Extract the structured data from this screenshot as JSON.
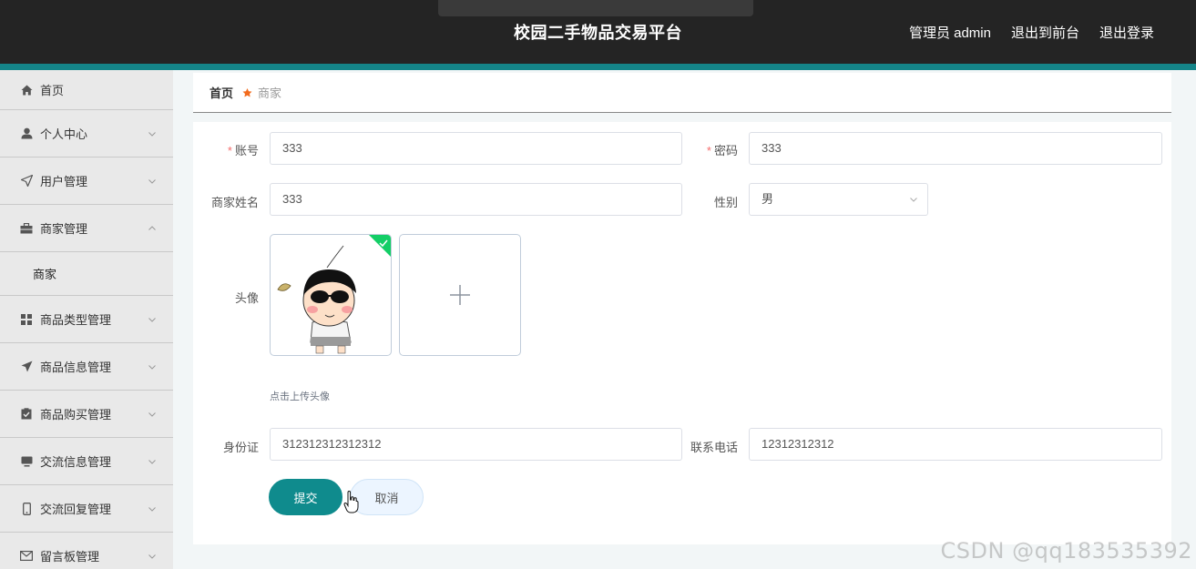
{
  "header": {
    "title": "校园二手物品交易平台",
    "user_label": "管理员 admin",
    "to_front_label": "退出到前台",
    "logout_label": "退出登录"
  },
  "sidebar": {
    "items": [
      {
        "label": "首页",
        "icon": "home-icon"
      },
      {
        "label": "个人中心",
        "icon": "user-icon"
      },
      {
        "label": "用户管理",
        "icon": "send-icon"
      },
      {
        "label": "商家管理",
        "icon": "briefcase-icon",
        "expanded": true,
        "children": [
          {
            "label": "商家"
          }
        ]
      },
      {
        "label": "商品类型管理",
        "icon": "grid-icon"
      },
      {
        "label": "商品信息管理",
        "icon": "paper-plane-icon"
      },
      {
        "label": "商品购买管理",
        "icon": "clipboard-check-icon"
      },
      {
        "label": "交流信息管理",
        "icon": "monitor-icon"
      },
      {
        "label": "交流回复管理",
        "icon": "mobile-icon"
      },
      {
        "label": "留言板管理",
        "icon": "mail-icon"
      }
    ]
  },
  "breadcrumb": {
    "home": "首页",
    "current": "商家",
    "separator_icon": "star-icon"
  },
  "form": {
    "account": {
      "label": "账号",
      "value": "333",
      "required": true
    },
    "password": {
      "label": "密码",
      "value": "333",
      "required": true
    },
    "merchant_name": {
      "label": "商家姓名",
      "value": "333"
    },
    "gender": {
      "label": "性别",
      "value": "男"
    },
    "avatar": {
      "label": "头像",
      "tip": "点击上传头像"
    },
    "id_card": {
      "label": "身份证",
      "value": "312312312312312"
    },
    "phone": {
      "label": "联系电话",
      "value": "12312312312"
    },
    "submit_label": "提交",
    "cancel_label": "取消"
  },
  "watermark": "CSDN @qq183535392",
  "colors": {
    "header_bg": "#242424",
    "accent": "#148488",
    "submit_bg": "#0f8b8d",
    "required": "#f56c6c",
    "success": "#13ce66"
  }
}
